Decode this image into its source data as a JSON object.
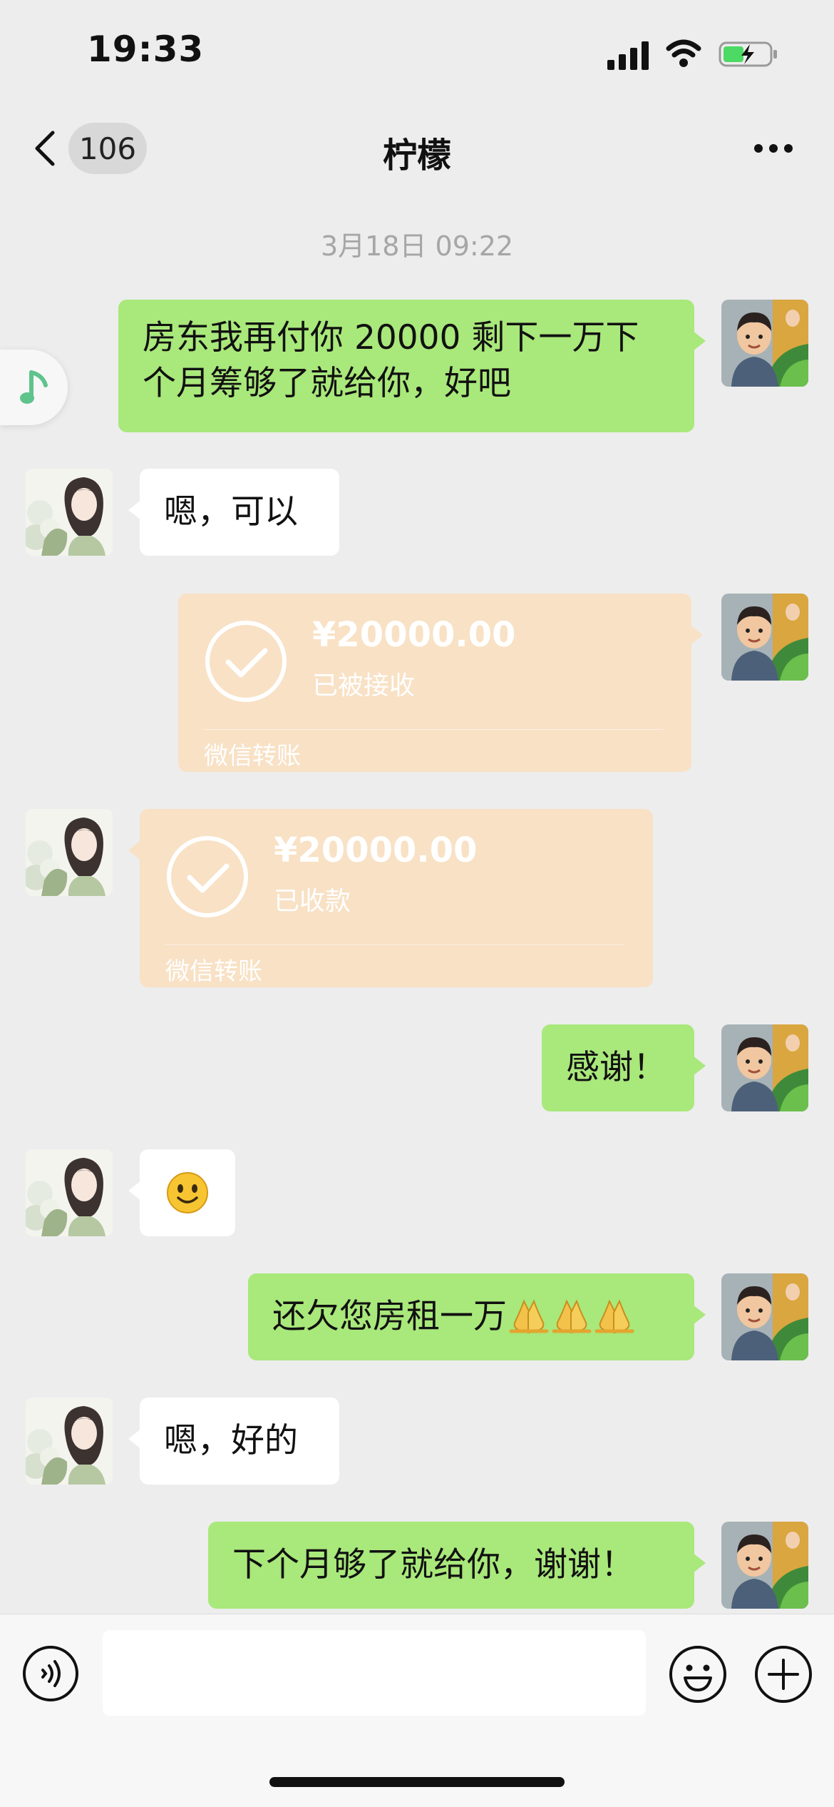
{
  "status_bar": {
    "time": "19:33"
  },
  "header": {
    "back_badge": "106",
    "title": "柠檬"
  },
  "timestamp": "3月18日 09:22",
  "messages": [
    {
      "from": "me",
      "text": "房东我再付你 20000 剩下一万下个月筹够了就给你，好吧"
    },
    {
      "from": "them",
      "text": "嗯，可以"
    },
    {
      "from": "me",
      "type": "transfer",
      "amount": "¥20000.00",
      "status": "已被接收",
      "footer": "微信转账"
    },
    {
      "from": "them",
      "type": "transfer",
      "amount": "¥20000.00",
      "status": "已收款",
      "footer": "微信转账"
    },
    {
      "from": "me",
      "text": "感谢！"
    },
    {
      "from": "them",
      "type": "emoji",
      "emoji": "smile-emoji"
    },
    {
      "from": "me",
      "text": "还欠您房租一万",
      "trailing_emoji": [
        "pray-emoji",
        "pray-emoji",
        "pray-emoji"
      ]
    },
    {
      "from": "them",
      "text": "嗯，好的"
    },
    {
      "from": "me",
      "text": "下个月够了就给你，谢谢！"
    }
  ],
  "input_bar": {
    "placeholder": ""
  },
  "icons": {
    "back": "chevron-left-icon",
    "more": "more-icon",
    "music": "music-note-icon",
    "voice": "voice-icon",
    "sticker": "smile-icon",
    "plus": "plus-icon",
    "check": "check-circle-icon"
  },
  "colors": {
    "background": "#ededed",
    "my_bubble": "#a9e87b",
    "their_bubble": "#ffffff",
    "transfer_bubble": "#f8e1c5",
    "timestamp": "#a6a6a6"
  }
}
